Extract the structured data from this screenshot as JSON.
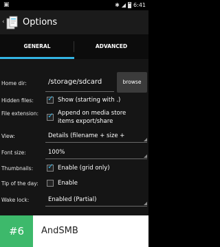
{
  "status_bar": {
    "time": "6:41"
  },
  "action_bar": {
    "title": "Options",
    "up_glyph": "‹"
  },
  "tabs": [
    {
      "label": "GENERAL",
      "active": true
    },
    {
      "label": "ADVANCED",
      "active": false
    }
  ],
  "general": {
    "home_dir": {
      "label": "Home dir:",
      "value": "/storage/sdcard",
      "browse_label": "browse"
    },
    "hidden_files": {
      "label": "Hidden files:",
      "checked": true,
      "text": "Show (starting with .)"
    },
    "file_extension": {
      "label": "File extension:",
      "checked": true,
      "text_line1": "Append on media store",
      "text_line2": "items export/share"
    },
    "view": {
      "label": "View:",
      "value": "Details (filename + size +"
    },
    "font_size": {
      "label": "Font size:",
      "value": "100%"
    },
    "thumbnails": {
      "label": "Thumbnails:",
      "checked": true,
      "text": "Enable (grid only)"
    },
    "tip_of_day": {
      "label": "Tip of the day:",
      "checked": false,
      "text": "Enable"
    },
    "wake_lock": {
      "label": "Wake lock:",
      "value": "Enabled (Partial)"
    }
  },
  "banner": {
    "rank": "#6",
    "app_name": "AndSMB",
    "badge_color": "#3db96b"
  },
  "colors": {
    "accent": "#33b5e5",
    "background": "#151515"
  }
}
